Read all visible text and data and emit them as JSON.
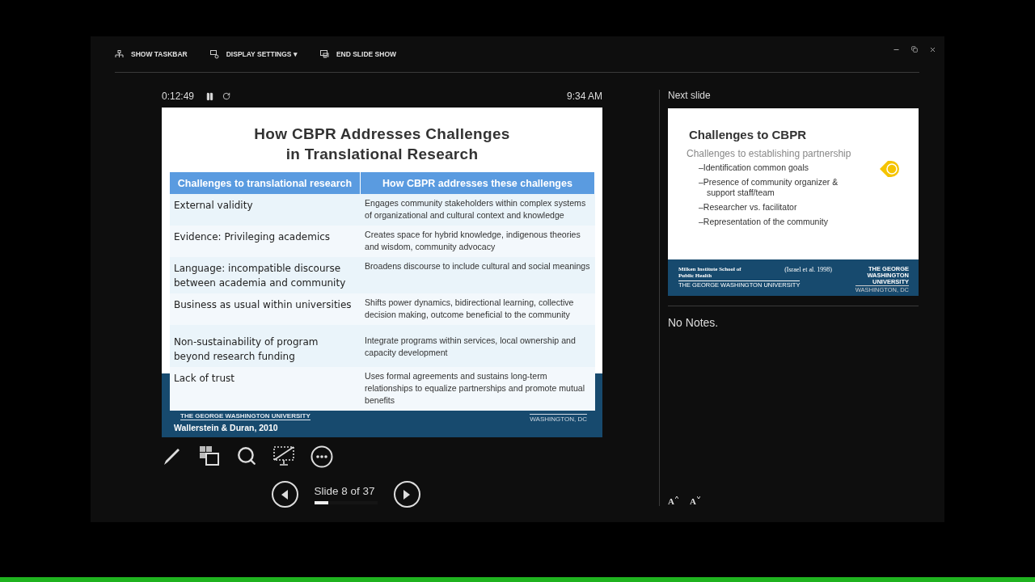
{
  "toolbar": [
    {
      "kind": "taskbar",
      "label": "SHOW TASKBAR"
    },
    {
      "kind": "display",
      "label": "DISPLAY SETTINGS ▾"
    },
    {
      "kind": "end",
      "label": "END SLIDE SHOW"
    }
  ],
  "timer": "0:12:49",
  "clock": "9:34 AM",
  "current_slide": {
    "title_lines": [
      "How CBPR Addresses Challenges",
      "in Translational Research"
    ],
    "table": {
      "columns": [
        "Challenges to translational research",
        "How CBPR addresses these challenges"
      ],
      "rows": [
        {
          "challenge": "External validity",
          "response": "Engages community stakeholders within complex systems of organizational and cultural context and knowledge"
        },
        {
          "challenge": "Evidence: Privileging academics",
          "response": "Creates space for hybrid knowledge, indigenous theories and wisdom, community advocacy"
        },
        {
          "challenge": "Language: incompatible discourse between academia and community",
          "response": "Broadens discourse to include cultural and social meanings"
        },
        {
          "challenge": "Business as usual within universities",
          "response": "Shifts power dynamics, bidirectional learning, collective decision making, outcome beneficial to the community"
        },
        {
          "challenge": "Non-sustainability of program beyond research funding",
          "response": "Integrate programs within services, local ownership and capacity development"
        },
        {
          "challenge": "Lack of trust",
          "response": "Uses formal agreements and sustains long-term relationships to equalize partnerships and promote mutual benefits"
        }
      ]
    },
    "footer": {
      "university": "THE GEORGE WASHINGTON UNIVERSITY",
      "citation": "Wallerstein & Duran, 2010",
      "location": "WASHINGTON, DC"
    }
  },
  "navigation": {
    "label": "Slide 8 of 37",
    "level": 0.22
  },
  "next_slide": {
    "heading": "Next slide",
    "title": "Challenges to CBPR",
    "subtitle": "Challenges to establishing partnership",
    "bullets": [
      "–Identification common goals",
      "–Presence of community organizer & support staff/team",
      "–Researcher vs. facilitator",
      "–Representation of the community"
    ],
    "footer": {
      "school": "Milken Institute School of Public Health",
      "school_line": "THE GEORGE WASHINGTON UNIVERSITY",
      "citation": "(Israel et al. 1998)",
      "logo": "THE GEORGE WASHINGTON UNIVERSITY",
      "location": "WASHINGTON, DC"
    }
  },
  "notes": "No Notes.",
  "font_buttons": [
    "A",
    "A"
  ]
}
